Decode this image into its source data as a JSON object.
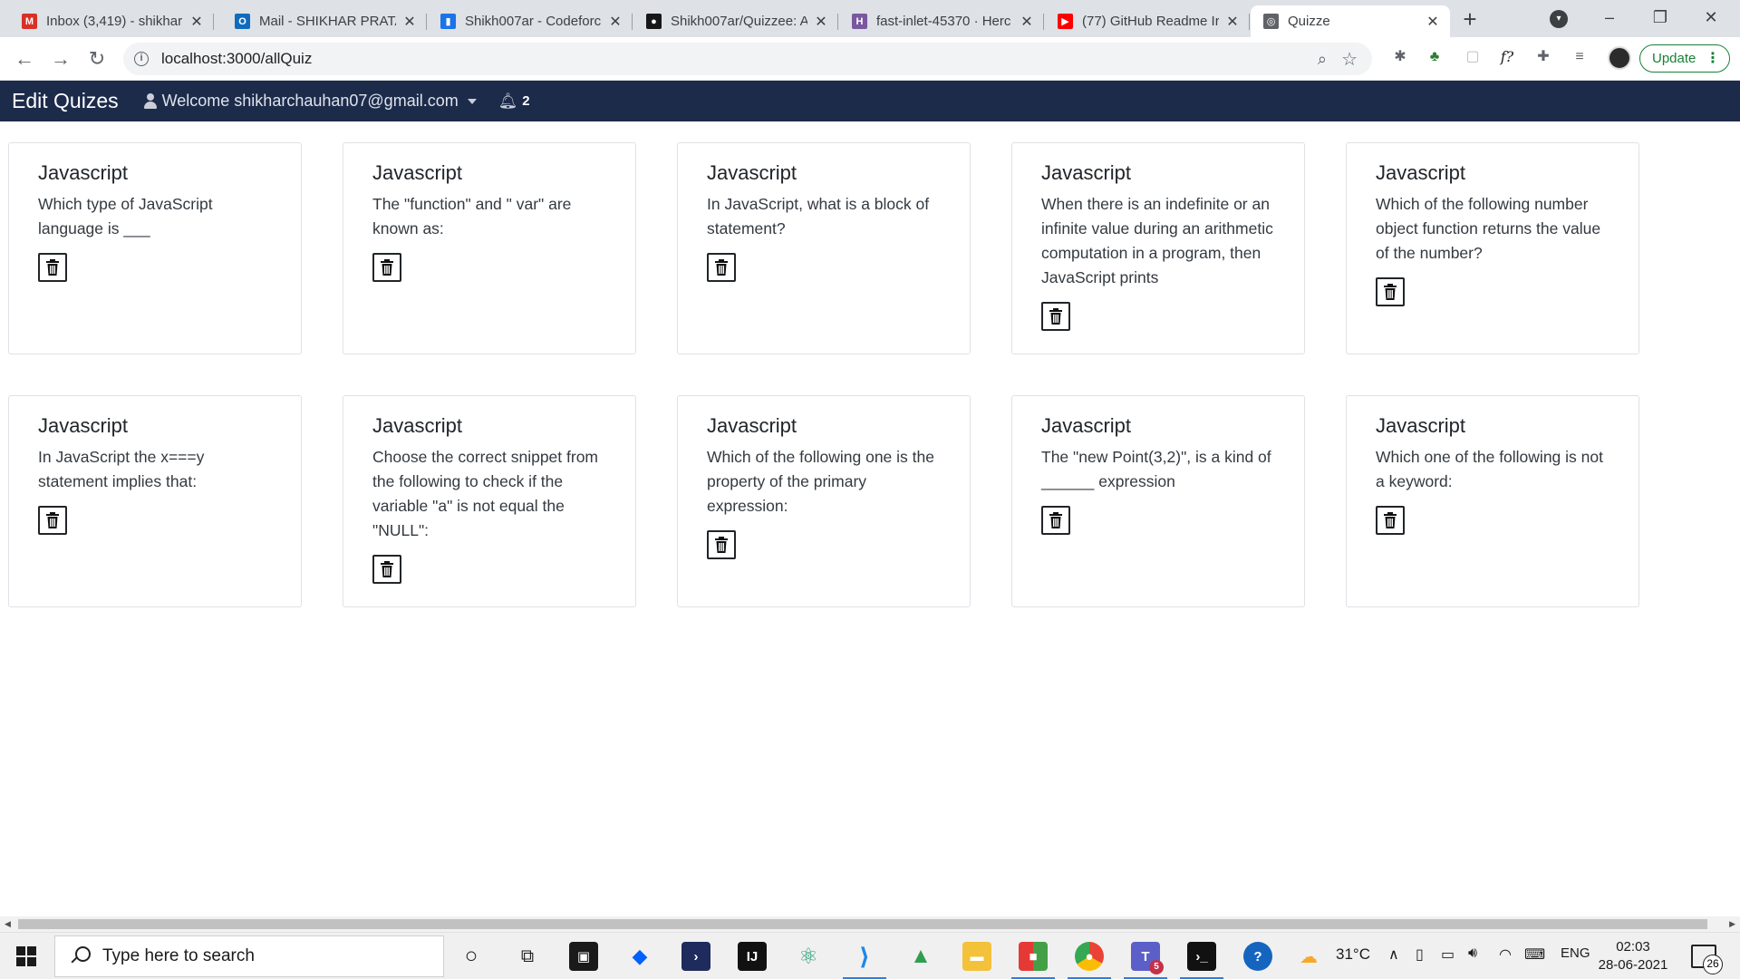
{
  "browser": {
    "tabs": [
      {
        "title": "Inbox (3,419) - shikhar",
        "icon": "gmail-icon",
        "color": "#d93025",
        "glyph": "M"
      },
      {
        "title": "Mail - SHIKHAR PRATA",
        "icon": "outlook-icon",
        "color": "#0f6cbd",
        "glyph": "O"
      },
      {
        "title": "Shikh007ar - Codeforc",
        "icon": "codeforces-icon",
        "color": "#1a73e8",
        "glyph": "▮"
      },
      {
        "title": "Shikh007ar/Quizzee: A",
        "icon": "github-icon",
        "color": "#181717",
        "glyph": "●"
      },
      {
        "title": "fast-inlet-45370 · Herc",
        "icon": "heroku-icon",
        "color": "#79589f",
        "glyph": "H"
      },
      {
        "title": "(77) GitHub Readme Ir",
        "icon": "youtube-icon",
        "color": "#ff0000",
        "glyph": "▶"
      },
      {
        "title": "Quizze",
        "icon": "globe-icon",
        "color": "#5f6368",
        "glyph": "◎"
      }
    ],
    "url": "localhost:3000/allQuiz",
    "update_label": "Update"
  },
  "navbar": {
    "brand": "Edit Quizes",
    "welcome": "Welcome shikharchauhan07@gmail.com",
    "notification_count": "2"
  },
  "quizzes": [
    {
      "title": "Javascript",
      "question": "Which type of JavaScript language is ___"
    },
    {
      "title": "Javascript",
      "question": "The \"function\" and \" var\" are known as:"
    },
    {
      "title": "Javascript",
      "question": "In JavaScript, what is a block of statement?"
    },
    {
      "title": "Javascript",
      "question": "When there is an indefinite or an infinite value during an arithmetic computation in a program, then JavaScript prints"
    },
    {
      "title": "Javascript",
      "question": "Which of the following number object function returns the value of the number?"
    },
    {
      "title": "Javascript",
      "question": "In JavaScript the x===y statement implies that:"
    },
    {
      "title": "Javascript",
      "question": "Choose the correct snippet from the following to check if the variable \"a\" is not equal the \"NULL\":"
    },
    {
      "title": "Javascript",
      "question": "Which of the following one is the property of the primary expression:"
    },
    {
      "title": "Javascript",
      "question": "The \"new Point(3,2)\", is a kind of ______ expression"
    },
    {
      "title": "Javascript",
      "question": "Which one of the following is not a keyword:"
    }
  ],
  "taskbar": {
    "search_placeholder": "Type here to search",
    "weather": "31°C",
    "language": "ENG",
    "time": "02:03",
    "date": "28-06-2021",
    "notification_badge": "26",
    "teams_badge": "5"
  }
}
